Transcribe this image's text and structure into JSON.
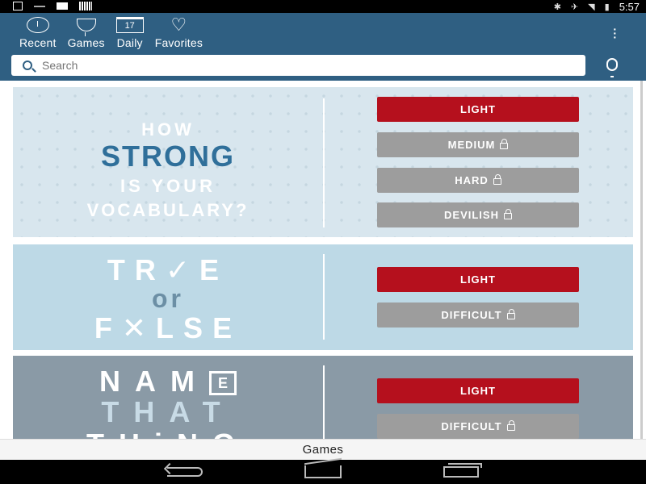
{
  "status_bar": {
    "time": "5:57",
    "icons": [
      "download-icon",
      "notification-icon",
      "message-icon",
      "barcode-icon",
      "bluetooth-icon",
      "mute-icon",
      "wifi-icon",
      "battery-icon"
    ]
  },
  "nav": {
    "tabs": [
      {
        "label": "Recent",
        "icon": "clock-icon"
      },
      {
        "label": "Games",
        "icon": "trophy-icon"
      },
      {
        "label": "Daily",
        "icon": "calendar-icon",
        "icon_text": "17"
      },
      {
        "label": "Favorites",
        "icon": "heart-icon"
      }
    ]
  },
  "search": {
    "placeholder": "Search"
  },
  "games": [
    {
      "title_lines": [
        "HOW",
        "STRONG",
        "IS YOUR",
        "VOCABULARY?"
      ],
      "buttons": [
        {
          "label": "LIGHT",
          "locked": false
        },
        {
          "label": "MEDIUM",
          "locked": true
        },
        {
          "label": "HARD",
          "locked": true
        },
        {
          "label": "DEVILISH",
          "locked": true
        }
      ]
    },
    {
      "title_lines": [
        "TR✓E",
        "or",
        "F✕LSE"
      ],
      "buttons": [
        {
          "label": "LIGHT",
          "locked": false
        },
        {
          "label": "DIFFICULT",
          "locked": true
        }
      ]
    },
    {
      "title_lines": [
        "NAM",
        "THAT",
        "THiNG"
      ],
      "badge": "E",
      "buttons": [
        {
          "label": "LIGHT",
          "locked": false
        },
        {
          "label": "DIFFICULT",
          "locked": true
        }
      ]
    }
  ],
  "bottom_label": "Games",
  "colors": {
    "app_bar": "#2f5f82",
    "accent_red": "#b5101d",
    "locked_gray": "#9d9d9d"
  }
}
